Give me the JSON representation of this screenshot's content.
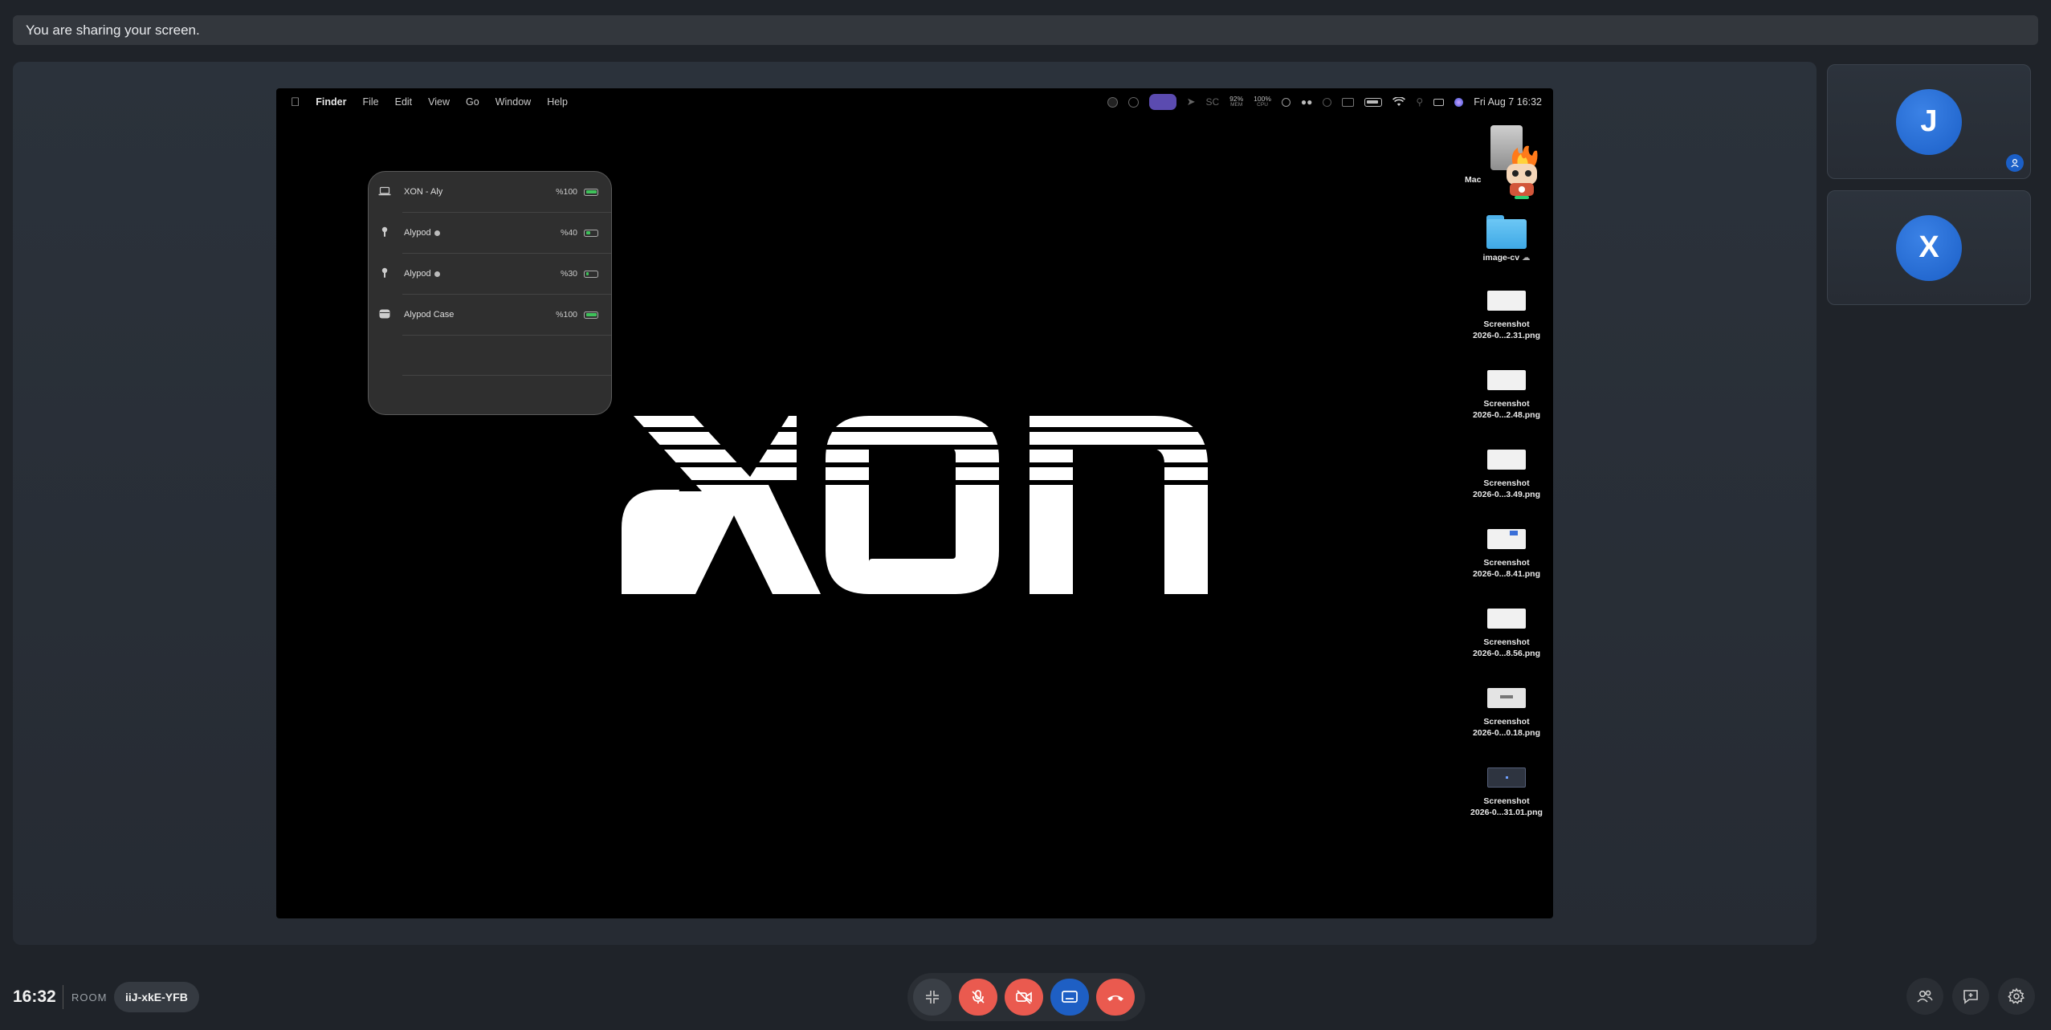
{
  "banner": {
    "text": "You are sharing your screen."
  },
  "mac": {
    "menu": {
      "app": "Finder",
      "items": [
        "File",
        "Edit",
        "View",
        "Go",
        "Window",
        "Help"
      ]
    },
    "status": {
      "sc_label": "SC",
      "mem_value": "92%",
      "mem_label": "MEM",
      "cpu_value": "100%",
      "cpu_label": "CPU",
      "datetime": "Fri Aug 7  16:32"
    },
    "battery_panel": {
      "devices": [
        {
          "name": "XON - Aly",
          "percent": "%100",
          "level": 1.0,
          "icon": "laptop-icon"
        },
        {
          "name": "Alypod",
          "percent": "%40",
          "level": 0.4,
          "icon": "airpod-icon"
        },
        {
          "name": "Alypod",
          "percent": "%30",
          "level": 0.3,
          "icon": "airpod-icon"
        },
        {
          "name": "Alypod Case",
          "percent": "%100",
          "level": 1.0,
          "icon": "airpod-case-icon"
        }
      ]
    },
    "logo_text": "XON",
    "desktop": {
      "drive_label": "Mac",
      "folder": "image-cv",
      "screenshots": [
        {
          "line1": "Screenshot",
          "line2": "2026-0...2.31.png"
        },
        {
          "line1": "Screenshot",
          "line2": "2026-0...2.48.png"
        },
        {
          "line1": "Screenshot",
          "line2": "2026-0...3.49.png"
        },
        {
          "line1": "Screenshot",
          "line2": "2026-0...8.41.png"
        },
        {
          "line1": "Screenshot",
          "line2": "2026-0...8.56.png"
        },
        {
          "line1": "Screenshot",
          "line2": "2026-0...0.18.png"
        },
        {
          "line1": "Screenshot",
          "line2": "2026-0...31.01.png"
        }
      ]
    }
  },
  "participants": [
    {
      "initial": "J",
      "badge": "user-badge-icon"
    },
    {
      "initial": "X"
    }
  ],
  "bottom": {
    "time": "16:32",
    "room_label": "ROOM",
    "room_code": "iiJ-xkE-YFB",
    "controls": [
      "minimize-icon",
      "mic-off-icon",
      "camera-off-icon",
      "screen-share-icon",
      "end-call-icon"
    ],
    "right": [
      "participants-icon",
      "chat-icon",
      "settings-icon"
    ]
  },
  "colors": {
    "accent_blue": "#1e5fc4",
    "danger_red": "#ea5a4f",
    "battery_green": "#3ec15a"
  }
}
